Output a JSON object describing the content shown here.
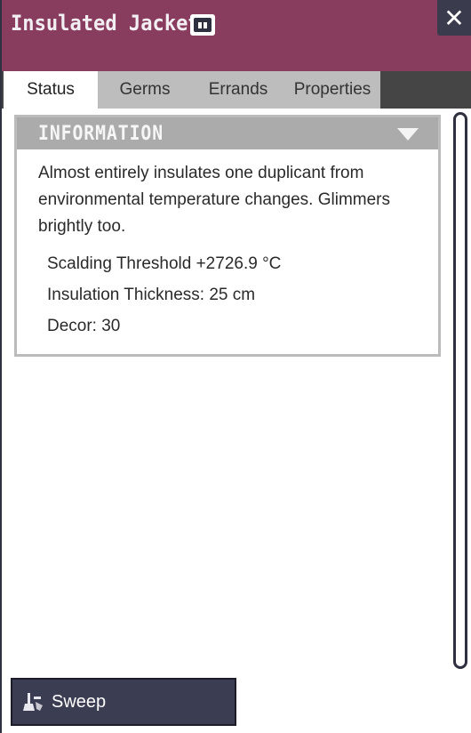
{
  "window": {
    "title": "Insulated Jacket",
    "close_label": "✕",
    "codex_icon": "book-icon"
  },
  "tabs": [
    {
      "label": "Status",
      "active": true
    },
    {
      "label": "Germs",
      "active": false
    },
    {
      "label": "Errands",
      "active": false
    },
    {
      "label": "Properties",
      "active": false
    }
  ],
  "information": {
    "header": "INFORMATION",
    "description": "Almost entirely insulates one duplicant from environmental temperature changes. Glimmers brightly too.",
    "stats": [
      "Scalding Threshold +2726.9 °C",
      "Insulation Thickness: 25 cm",
      "Decor: 30"
    ]
  },
  "actions": {
    "sweep_label": "Sweep",
    "sweep_icon": "broom-icon"
  },
  "colors": {
    "header_bg": "#883d5f",
    "tab_inactive": "#bdbdbd",
    "tab_bar": "#454545",
    "section_header": "#ababab",
    "button_bg": "#3b3e52"
  }
}
